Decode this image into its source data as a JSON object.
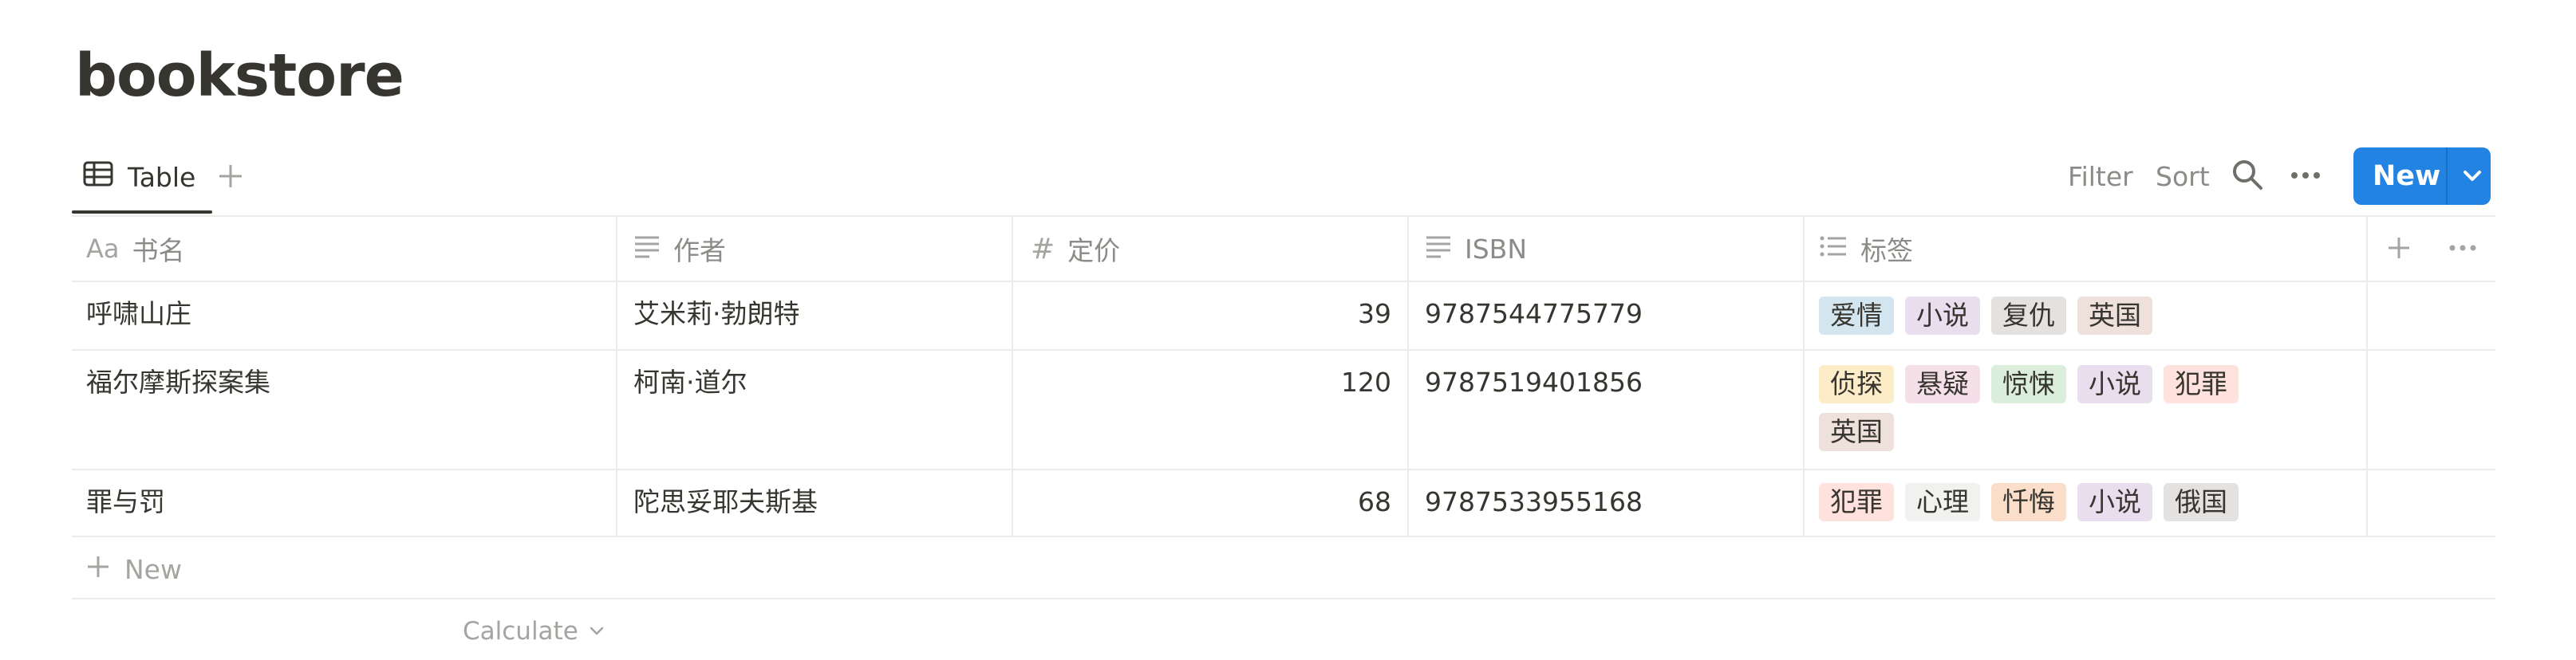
{
  "page": {
    "title": "bookstore"
  },
  "views": {
    "active_tab": "Table",
    "add_icon": "plus-icon"
  },
  "toolbar": {
    "filter_label": "Filter",
    "sort_label": "Sort",
    "search_icon": "search-icon",
    "more_icon": "more-icon",
    "new_label": "New",
    "new_caret_icon": "chevron-down-icon",
    "accent_color": "#2383e2"
  },
  "table": {
    "columns": [
      {
        "label": "书名",
        "type_icon": "Aa"
      },
      {
        "label": "作者",
        "type_icon": "text-lines-icon"
      },
      {
        "label": "定价",
        "type_icon": "#"
      },
      {
        "label": "ISBN",
        "type_icon": "text-lines-icon"
      },
      {
        "label": "标签",
        "type_icon": "list-icon"
      }
    ],
    "rows": [
      {
        "title": "呼啸山庄",
        "author": "艾米莉·勃朗特",
        "price": "39",
        "isbn": "9787544775779",
        "tags": [
          {
            "label": "爱情",
            "bg": "#d3e5ef"
          },
          {
            "label": "小说",
            "bg": "#e8deee"
          },
          {
            "label": "复仇",
            "bg": "#e3e2e0"
          },
          {
            "label": "英国",
            "bg": "#eee0da"
          }
        ]
      },
      {
        "title": "福尔摩斯探案集",
        "author": "柯南·道尔",
        "price": "120",
        "isbn": "9787519401856",
        "tags": [
          {
            "label": "侦探",
            "bg": "#fdecc8"
          },
          {
            "label": "悬疑",
            "bg": "#f5e0e9"
          },
          {
            "label": "惊悚",
            "bg": "#dbeddb"
          },
          {
            "label": "小说",
            "bg": "#e8deee"
          },
          {
            "label": "犯罪",
            "bg": "#ffe2dd"
          },
          {
            "label": "英国",
            "bg": "#eee0da"
          }
        ]
      },
      {
        "title": "罪与罚",
        "author": "陀思妥耶夫斯基",
        "price": "68",
        "isbn": "9787533955168",
        "tags": [
          {
            "label": "犯罪",
            "bg": "#ffe2dd"
          },
          {
            "label": "心理",
            "bg": "#f1f1ef"
          },
          {
            "label": "忏悔",
            "bg": "#fadec9"
          },
          {
            "label": "小说",
            "bg": "#e8deee"
          },
          {
            "label": "俄国",
            "bg": "#e3e2e0"
          }
        ]
      }
    ],
    "new_row_label": "New",
    "calculate_label": "Calculate"
  }
}
